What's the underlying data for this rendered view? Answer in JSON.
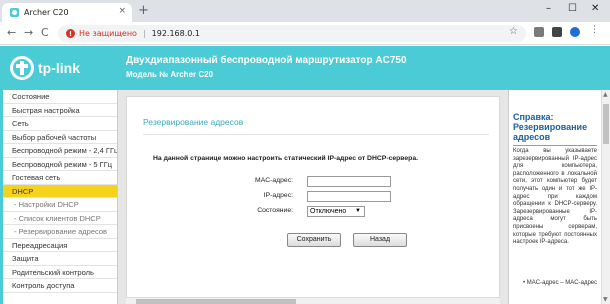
{
  "browser": {
    "tab_title": "Archer C20",
    "tab_close": "×",
    "new_tab": "+",
    "minimize": "–",
    "maximize": "☐",
    "close": "✕",
    "back": "←",
    "forward": "→",
    "reload": "C",
    "security_warning": "Не защищено",
    "separator": "|",
    "url": "192.168.0.1",
    "bookmark": "☆"
  },
  "header": {
    "logo_text": "tp-link",
    "title": "Двухдиапазонный беспроводной маршрутизатор AC750",
    "model": "Модель № Archer C20",
    "color": "#4acbd6"
  },
  "sidebar": {
    "items": [
      {
        "label": "Состояние",
        "state": "normal"
      },
      {
        "label": "Быстрая настройка",
        "state": "normal"
      },
      {
        "label": "Сеть",
        "state": "normal"
      },
      {
        "label": "Выбор рабочей частоты",
        "state": "normal"
      },
      {
        "label": "Беспроводной режим - 2,4 ГГц",
        "state": "normal"
      },
      {
        "label": "Беспроводной режим - 5 ГГц",
        "state": "normal"
      },
      {
        "label": "Гостевая сеть",
        "state": "normal"
      },
      {
        "label": "DHCP",
        "state": "active"
      },
      {
        "label": "- Настройки DHCP",
        "state": "sub"
      },
      {
        "label": "- Список клиентов DHCP",
        "state": "sub"
      },
      {
        "label": "- Резервирование адресов",
        "state": "sub"
      },
      {
        "label": "Переадресация",
        "state": "normal"
      },
      {
        "label": "Защита",
        "state": "normal"
      },
      {
        "label": "Родительский контроль",
        "state": "normal"
      },
      {
        "label": "Контроль доступа",
        "state": "normal"
      }
    ],
    "active_color": "#f5d31d"
  },
  "main": {
    "title": "Резервирование адресов",
    "description": "На данной странице можно настроить статический IP-адрес от DHCP-сервера.",
    "mac_label": "MAC-адрес:",
    "mac_value": "",
    "ip_label": "IP-адрес:",
    "ip_value": "",
    "state_label": "Состояние:",
    "state_value": "Отключено",
    "save_button": "Сохранить",
    "back_button": "Назад"
  },
  "help": {
    "title": "Справка: Резервирование адресов",
    "text": "Когда вы указываете зарезервированный IP-адрес для компьютера, расположенного в локальной сети, этот компьютер будет получать один и тот же IP-адрес при каждом обращении к DHCP-серверу. Зарезервированные IP-адреса могут быть присвоены серверам, которые требуют постоянных настроек IP-адреса.",
    "bullet": "• MAC-адрес – MAC-адрес"
  }
}
